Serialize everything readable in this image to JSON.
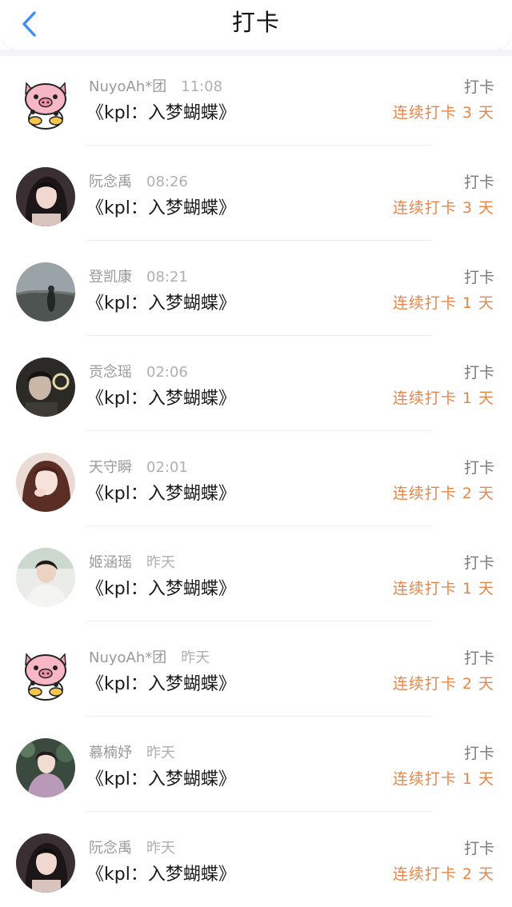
{
  "header": {
    "title": "打卡",
    "back_icon": "chevron-left-icon",
    "accent": "#3b8ff7"
  },
  "colors": {
    "streak": "#e8864a",
    "meta": "#9a9a9a",
    "title": "#1a1a1a"
  },
  "entries": [
    {
      "name": "NuyoAh*团",
      "time": "11:08",
      "book": "《kpl：入梦蝴蝶》",
      "action": "打卡",
      "streak": "连续打卡 3 天",
      "avatar": "pig-cartoon-avatar"
    },
    {
      "name": "阮念禹",
      "time": "08:26",
      "book": "《kpl：入梦蝴蝶》",
      "action": "打卡",
      "streak": "连续打卡 3 天",
      "avatar": "portrait-avatar"
    },
    {
      "name": "登凯康",
      "time": "08:21",
      "book": "《kpl：入梦蝴蝶》",
      "action": "打卡",
      "streak": "连续打卡 1 天",
      "avatar": "landscape-avatar"
    },
    {
      "name": "贡念瑶",
      "time": "02:06",
      "book": "《kpl：入梦蝴蝶》",
      "action": "打卡",
      "streak": "连续打卡 1 天",
      "avatar": "portrait-avatar"
    },
    {
      "name": "天守瞬",
      "time": "02:01",
      "book": "《kpl：入梦蝴蝶》",
      "action": "打卡",
      "streak": "连续打卡 2 天",
      "avatar": "portrait-avatar"
    },
    {
      "name": "姬涵瑶",
      "time": "昨天",
      "book": "《kpl：入梦蝴蝶》",
      "action": "打卡",
      "streak": "连续打卡 1 天",
      "avatar": "portrait-avatar"
    },
    {
      "name": "NuyoAh*团",
      "time": "昨天",
      "book": "《kpl：入梦蝴蝶》",
      "action": "打卡",
      "streak": "连续打卡 2 天",
      "avatar": "pig-cartoon-avatar"
    },
    {
      "name": "慕楠妤",
      "time": "昨天",
      "book": "《kpl：入梦蝴蝶》",
      "action": "打卡",
      "streak": "连续打卡 1 天",
      "avatar": "portrait-avatar"
    },
    {
      "name": "阮念禹",
      "time": "昨天",
      "book": "《kpl：入梦蝴蝶》",
      "action": "打卡",
      "streak": "连续打卡 2 天",
      "avatar": "portrait-avatar"
    }
  ]
}
